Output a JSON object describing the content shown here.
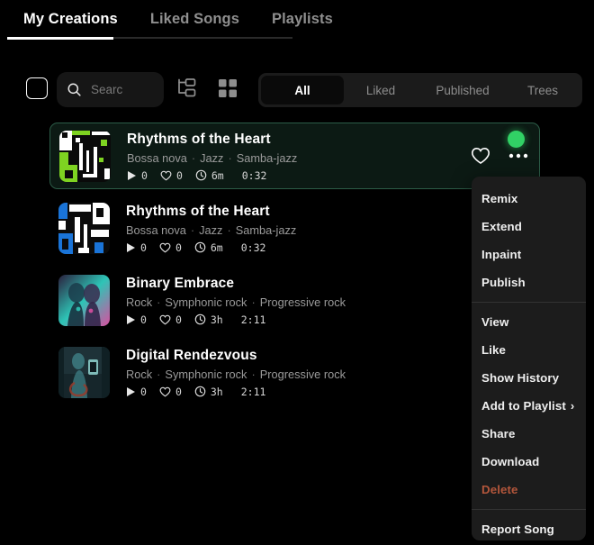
{
  "topnav": {
    "tabs": [
      {
        "label": "My Creations",
        "active": true
      },
      {
        "label": "Liked Songs",
        "active": false
      },
      {
        "label": "Playlists",
        "active": false
      }
    ]
  },
  "toolbar": {
    "select_all_checked": false,
    "search": {
      "value": "",
      "placeholder": "Searc"
    },
    "tree_view_icon": "folder-tree-icon",
    "grid_view_icon": "grid-icon",
    "filters": [
      {
        "label": "All",
        "active": true
      },
      {
        "label": "Liked",
        "active": false
      },
      {
        "label": "Published",
        "active": false
      },
      {
        "label": "Trees",
        "active": false
      }
    ]
  },
  "songs": [
    {
      "title": "Rhythms of the Heart",
      "tags": [
        "Bossa nova",
        "Jazz",
        "Samba-jazz"
      ],
      "plays": "0",
      "likes": "0",
      "age": "6m",
      "duration": "0:32",
      "selected": true,
      "status_dot": true,
      "thumb_colors": [
        "#7ed321",
        "#0a0a0a",
        "#ffffff"
      ]
    },
    {
      "title": "Rhythms of the Heart",
      "tags": [
        "Bossa nova",
        "Jazz",
        "Samba-jazz"
      ],
      "plays": "0",
      "likes": "0",
      "age": "6m",
      "duration": "0:32",
      "selected": false,
      "status_dot": false,
      "thumb_colors": [
        "#1a74d8",
        "#0b0b0b",
        "#ffffff"
      ]
    },
    {
      "title": "Binary Embrace",
      "tags": [
        "Rock",
        "Symphonic rock",
        "Progressive rock"
      ],
      "plays": "0",
      "likes": "0",
      "age": "3h",
      "duration": "2:11",
      "selected": false,
      "status_dot": false,
      "thumb_colors": [
        "#d94fa0",
        "#2ec4b6",
        "#2a1f3d"
      ]
    },
    {
      "title": "Digital Rendezvous",
      "tags": [
        "Rock",
        "Symphonic rock",
        "Progressive rock"
      ],
      "plays": "0",
      "likes": "0",
      "age": "3h",
      "duration": "2:11",
      "selected": false,
      "status_dot": false,
      "thumb_colors": [
        "#3e7f86",
        "#16262b",
        "#8fd3cf"
      ]
    }
  ],
  "context_menu": {
    "groups": [
      {
        "items": [
          {
            "label": "Remix",
            "danger": false,
            "submenu": false
          },
          {
            "label": "Extend",
            "danger": false,
            "submenu": false
          },
          {
            "label": "Inpaint",
            "danger": false,
            "submenu": false
          },
          {
            "label": "Publish",
            "danger": false,
            "submenu": false
          }
        ]
      },
      {
        "items": [
          {
            "label": "View",
            "danger": false,
            "submenu": false
          },
          {
            "label": "Like",
            "danger": false,
            "submenu": false
          },
          {
            "label": "Show History",
            "danger": false,
            "submenu": false
          },
          {
            "label": "Add to Playlist",
            "danger": false,
            "submenu": true
          },
          {
            "label": "Share",
            "danger": false,
            "submenu": false
          },
          {
            "label": "Download",
            "danger": false,
            "submenu": false
          },
          {
            "label": "Delete",
            "danger": true,
            "submenu": false
          }
        ]
      },
      {
        "items": [
          {
            "label": "Report Song",
            "danger": false,
            "submenu": false
          }
        ]
      }
    ],
    "submenu_chevron": "›"
  },
  "colors": {
    "background": "#000000",
    "selected_row_bg": "#0c1a14",
    "selected_row_border": "#2c5c47",
    "status_green": "#31d165",
    "danger": "#b3563b",
    "menu_bg": "#1c1c1c",
    "accent_white": "#ffffff"
  }
}
